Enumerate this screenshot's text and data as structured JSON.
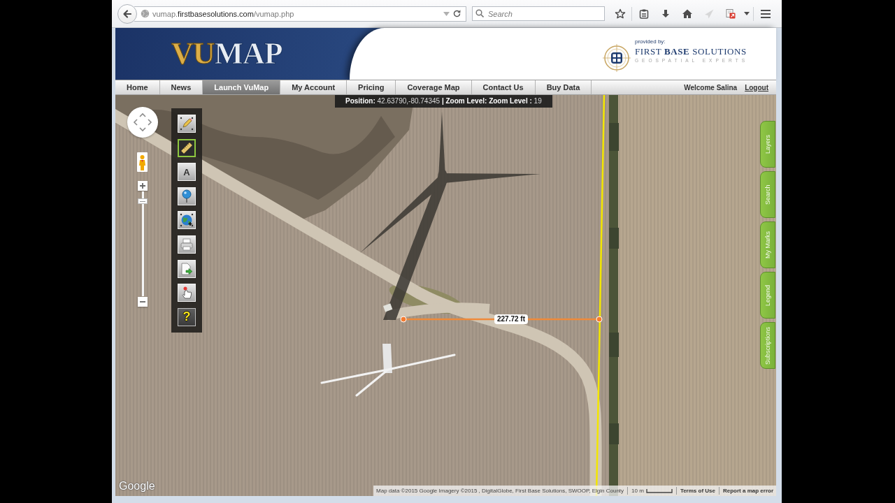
{
  "browser": {
    "url": {
      "subdomain": "vumap.",
      "domain": "firstbasesolutions.com",
      "path": "/vumap.php"
    },
    "search": {
      "placeholder": "Search"
    },
    "toolbar": [
      {
        "kind": "bookmark",
        "disabled": false
      },
      {
        "kind": "reading-list",
        "disabled": false
      },
      {
        "kind": "download",
        "disabled": false
      },
      {
        "kind": "home",
        "disabled": false
      },
      {
        "kind": "share",
        "disabled": true
      },
      {
        "kind": "pdf",
        "disabled": false
      },
      {
        "kind": "more",
        "disabled": false
      },
      {
        "kind": "menu",
        "disabled": false
      }
    ]
  },
  "header": {
    "logo": {
      "part_1": "VU",
      "part_2": "MAP"
    },
    "provider": {
      "caption": "provided by:",
      "name": "FIRST **BASE** SOLUTIONS",
      "tagline": "GEOSPATIAL EXPERTS"
    }
  },
  "nav": {
    "items": [
      {
        "label": "Home",
        "selected": false
      },
      {
        "label": "News",
        "selected": false
      },
      {
        "label": "Launch VuMap",
        "selected": true
      },
      {
        "label": "My Account",
        "selected": false
      },
      {
        "label": "Pricing",
        "selected": false
      },
      {
        "label": "Coverage Map",
        "selected": false
      },
      {
        "label": "Contact Us",
        "selected": false
      },
      {
        "label": "Buy Data",
        "selected": false
      }
    ],
    "welcome": "Welcome Salina",
    "logout": "Logout"
  },
  "map": {
    "status": "**Position:** 42.63790,-80.74345 **| Zoom Level: Zoom Level :** 19",
    "zoom_slider": {
      "level": 0.93
    },
    "tools": [
      {
        "kind": "draw",
        "selected": false
      },
      {
        "kind": "measure",
        "selected": true
      },
      {
        "kind": "label",
        "selected": false,
        "glyph": "A"
      },
      {
        "kind": "identify",
        "selected": false
      },
      {
        "kind": "globe",
        "selected": false
      },
      {
        "kind": "print",
        "selected": false
      },
      {
        "kind": "export",
        "selected": false
      },
      {
        "kind": "select",
        "selected": false
      },
      {
        "kind": "help",
        "selected": false,
        "glyph": "?"
      }
    ],
    "measurement": {
      "label": "227.72 ft"
    },
    "side_tabs": [
      {
        "label": "Layers",
        "selected": false
      },
      {
        "label": "Search",
        "selected": false
      },
      {
        "label": "My Marks",
        "selected": false
      },
      {
        "label": "Legend",
        "selected": false
      },
      {
        "label": "Subscriptions",
        "selected": false
      }
    ],
    "google_logo": "Google",
    "attribution": "Map data ©2015 Google Imagery ©2015 , DigitalGlobe, First Base Solutions, SWOOP, Elgin County",
    "scale": "10 m",
    "links": [
      "Terms of Use",
      "Report a map error"
    ]
  }
}
